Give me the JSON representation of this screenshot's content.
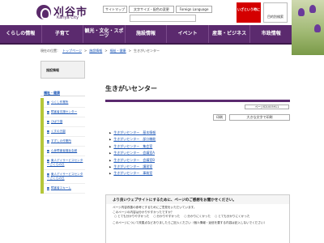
{
  "header": {
    "site_name": "刈谷市",
    "site_sub": "Kariya City",
    "top_links": [
      "サイトマップ",
      "文字サイズ・配色の変更",
      "Foreign Language"
    ],
    "search_placeholder": "",
    "emergency_label": "いざという時に",
    "purpose_label": "目的別検索"
  },
  "nav": [
    "くらしの情報",
    "子育て",
    "観光・文化・スポーツ",
    "施設情報",
    "イベント",
    "産業・ビジネス",
    "市政情報"
  ],
  "breadcrumbs": {
    "prefix": "現在の位置：",
    "items": [
      "トップページ",
      "施設情報",
      "福祉・健康",
      "生きがいセンター"
    ]
  },
  "sidebar": {
    "heading": "施設情報",
    "category": "福祉・健康",
    "items": [
      "つくし作業所",
      "障害者支援センター",
      "ひばり園",
      "くすのき園",
      "すずしの作業所",
      "心身障害者福祉会館",
      "東人デイサービスセンターさくらの丘",
      "東人デイサービスセンターさくらの丘",
      "障害者スキーム"
    ]
  },
  "main": {
    "title": "生きがいセンター",
    "page_id": "ページID1005911",
    "print_label": "印刷",
    "large_print_label": "大きな文字で印刷",
    "links": [
      "生きがいセンター　基本情報",
      "生きがいセンター　部分機能",
      "生きがいセンター　集会室",
      "生きがいセンター　会議室A",
      "生きがいセンター　会議室B",
      "生きがいセンター　講習室",
      "生きがいセンター　事務室"
    ]
  },
  "feedback": {
    "title": "より良いウェブサイトにするために、ページのご感想をお聞かせください。",
    "intro": "ページ内容改善の参考とするためにご意見をいただいています。",
    "q1": "このページの内容は分かりやすかったですか？",
    "q1_options": [
      "とても分かりやすかった",
      "分かりやすかった",
      "分かりにくかった",
      "とても分かりにくかった"
    ],
    "q2": "このページについて改善点などありましたらご記入ください（個人情報・返信を要する内容は記入しないでください）"
  }
}
